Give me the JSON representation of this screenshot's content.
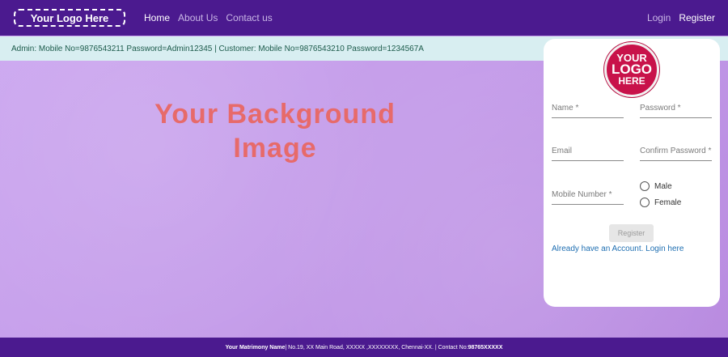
{
  "navbar": {
    "logo_text": "Your Logo Here",
    "links": [
      "Home",
      "About Us",
      "Contact us"
    ],
    "right_links": [
      "Login",
      "Register"
    ]
  },
  "info": {
    "text": "Admin: Mobile No=9876543211 Password=Admin12345 | Customer: Mobile No=9876543210 Password=1234567A"
  },
  "background": {
    "line1": "Your Background",
    "line2": "Image"
  },
  "card": {
    "logo": {
      "line1": "YOUR",
      "line2": "LOGO",
      "line3": "HERE"
    },
    "fields": {
      "name": "Name *",
      "password": "Password *",
      "email": "Email",
      "confirm_password": "Confirm Password *",
      "mobile": "Mobile Number *"
    },
    "gender": [
      "Male",
      "Female"
    ],
    "register_label": "Register",
    "login_text": "Already have an Account. Login here"
  },
  "footer": {
    "name": "Your Matrimony Name",
    "address": " | No.19, XX Main Road, XXXXX ,XXXXXXXX, Chennai-XX. | Contact No: ",
    "phone": "98765XXXXX"
  }
}
